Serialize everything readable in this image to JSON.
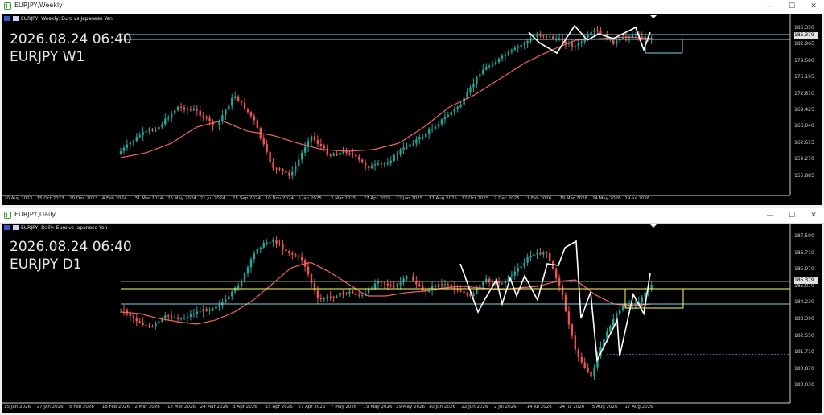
{
  "weekly": {
    "window_title": "EURJPY,Weekly",
    "subtitle": "EURJPY, Weekly:  Euro vs Japanese Yen",
    "clock": "2026.08.24 06:40",
    "symbol_tf": "EURJPY W1",
    "current_price": "185.379",
    "price_labels": [
      "186.350",
      "182.965",
      "179.580",
      "176.195",
      "172.810",
      "169.425",
      "166.040",
      "162.655",
      "159.270",
      "155.885"
    ],
    "date_labels": [
      "20 Aug 2023",
      "15 Oct 2023",
      "10 Dec 2023",
      "4 Feb 2024",
      "31 Mar 2024",
      "26 May 2024",
      "21 Jul 2024",
      "15 Sep 2024",
      "10 Nov 2024",
      "5 Jan 2025",
      "2 Mar 2025",
      "27 Apr 2025",
      "22 Jun 2025",
      "17 Aug 2025",
      "12 Oct 2025",
      "7 Dec 2025",
      "1 Feb 2026",
      "29 Mar 2026",
      "24 May 2026",
      "19 Jul 2026"
    ],
    "colors": {
      "up": "#26a69a",
      "down": "#ef5350",
      "ma": "#f0665a",
      "hline": "#7fd6e6",
      "zigzag": "#ffffff"
    }
  },
  "daily": {
    "window_title": "EURJPY,Daily",
    "subtitle": "EURJPY, Daily:  Euro vs Japanese Yen",
    "clock": "2026.08.24 06:40",
    "symbol_tf": "EURJPY D1",
    "current_price": "185.379",
    "price_labels": [
      "187.590",
      "186.710",
      "185.970",
      "185.070",
      "184.230",
      "183.390",
      "182.550",
      "181.710",
      "180.870",
      "180.030"
    ],
    "date_labels": [
      "15 Jan 2026",
      "27 Jan 2026",
      "6 Feb 2026",
      "18 Feb 2026",
      "2 Mar 2026",
      "12 Mar 2026",
      "24 Mar 2026",
      "3 Apr 2026",
      "15 Apr 2026",
      "27 Apr 2026",
      "7 May 2026",
      "19 May 2026",
      "29 May 2026",
      "10 Jun 2026",
      "22 Jun 2026",
      "2 Jul 2026",
      "14 Jul 2026",
      "24 Jul 2026",
      "5 Aug 2026",
      "17 Aug 2026"
    ],
    "colors": {
      "up": "#26a69a",
      "down": "#ef5350",
      "ma": "#f0665a",
      "hline_yellow": "#ffff66",
      "hline_cyan": "#7fd6e6",
      "zigzag": "#ffffff"
    }
  },
  "window_buttons": {
    "minimize": "—",
    "maximize": "☐",
    "close": "✕"
  }
}
